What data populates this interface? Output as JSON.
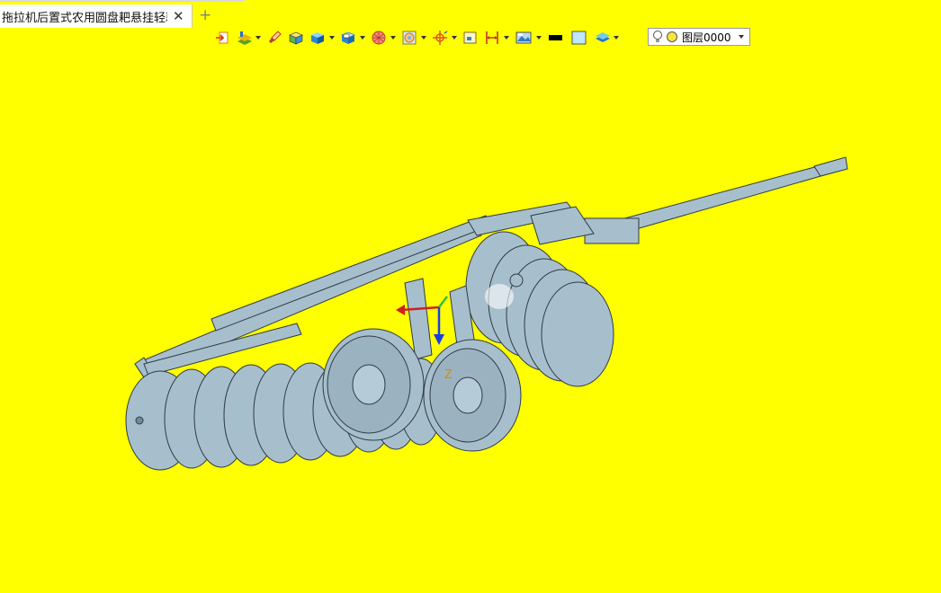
{
  "tab": {
    "title": "拖拉机后置式农用圆盘耙悬挂轻耙]",
    "close_glyph": "✕",
    "add_glyph": "+"
  },
  "toolbar": {
    "icons": [
      "import-icon",
      "layers-icon",
      "brush-icon",
      "solid-block-icon",
      "cube-icon",
      "display-mode-icon",
      "render-sphere-icon",
      "view-cube-icon",
      "target-origin-icon",
      "frame-icon",
      "dimension-icon",
      "workplane-icon",
      "color-black-swatch",
      "color-blue-swatch",
      "stack-layers-icon"
    ],
    "line_color": "#000000",
    "fill_color": "#bfe6ff"
  },
  "layer": {
    "name": "图层0000",
    "bulb_icon": "lightbulb-icon",
    "color_dot": "#f5e642"
  },
  "viewport": {
    "background": "#ffff00",
    "model_color": "#9fb9c9",
    "axis_label": "Z"
  }
}
